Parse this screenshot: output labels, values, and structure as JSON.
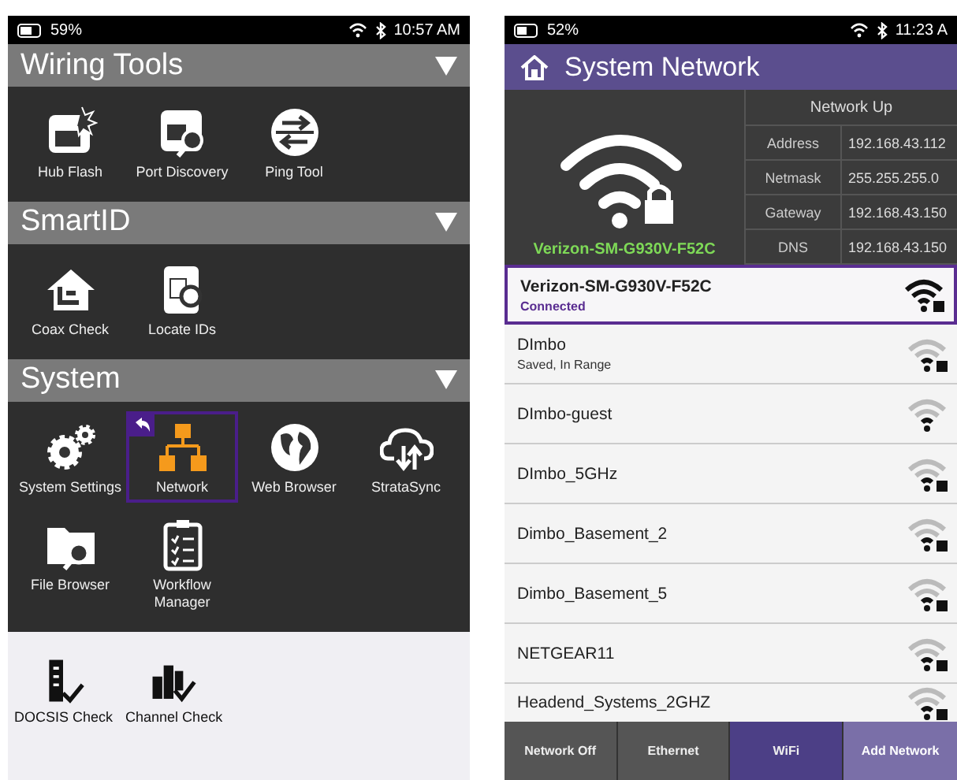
{
  "launcher": {
    "status_bar": {
      "battery": "59%",
      "time": "10:57 AM"
    },
    "sections": [
      {
        "title": "Wiring Tools",
        "tiles": [
          {
            "label": "Hub Flash",
            "kind": "hub",
            "selected": false
          },
          {
            "label": "Port Discovery",
            "kind": "port",
            "selected": false
          },
          {
            "label": "Ping Tool",
            "kind": "ping",
            "selected": false
          }
        ]
      },
      {
        "title": "SmartID",
        "tiles": [
          {
            "label": "Coax Check",
            "kind": "house",
            "selected": false
          },
          {
            "label": "Locate IDs",
            "kind": "locate",
            "selected": false
          }
        ]
      },
      {
        "title": "System",
        "tiles": [
          {
            "label": "System Settings",
            "kind": "gear",
            "selected": false
          },
          {
            "label": "Network",
            "kind": "network",
            "selected": true
          },
          {
            "label": "Web Browser",
            "kind": "globe",
            "selected": false
          },
          {
            "label": "StrataSync",
            "kind": "cloud",
            "selected": false
          },
          {
            "label": "File Browser",
            "kind": "folder",
            "selected": false
          },
          {
            "label": "Workflow Manager",
            "kind": "clipboard",
            "selected": false
          }
        ]
      }
    ],
    "footer_tiles": [
      {
        "label": "DOCSIS Check",
        "kind": "docsis"
      },
      {
        "label": "Channel Check",
        "kind": "channel"
      }
    ]
  },
  "network_screen": {
    "status_bar": {
      "battery": "52%",
      "time": "11:23 A"
    },
    "title": "System Network",
    "network_name": "Verizon-SM-G930V-F52C",
    "status": "Network Up",
    "details": [
      {
        "label": "Address",
        "value": "192.168.43.112"
      },
      {
        "label": "Netmask",
        "value": "255.255.255.0"
      },
      {
        "label": "Gateway",
        "value": "192.168.43.150"
      },
      {
        "label": "DNS",
        "value": "192.168.43.150"
      }
    ],
    "networks": [
      {
        "name": "Verizon-SM-G930V-F52C",
        "status": "Connected",
        "selected": true,
        "secured": true
      },
      {
        "name": "DImbo",
        "status": "Saved, In Range",
        "selected": false,
        "secured": true
      },
      {
        "name": "DImbo-guest",
        "selected": false,
        "secured": false
      },
      {
        "name": "DImbo_5GHz",
        "selected": false,
        "secured": true
      },
      {
        "name": "Dimbo_Basement_2",
        "selected": false,
        "secured": true
      },
      {
        "name": "Dimbo_Basement_5",
        "selected": false,
        "secured": true
      },
      {
        "name": "NETGEAR11",
        "selected": false,
        "secured": true
      },
      {
        "name": "Headend_Systems_2GHZ",
        "selected": false,
        "secured": true
      }
    ],
    "tabs": [
      {
        "label": "Network Off",
        "selected": false
      },
      {
        "label": "Ethernet",
        "selected": false
      },
      {
        "label": "WiFi",
        "selected": true
      }
    ],
    "action_button": "Add Network"
  }
}
